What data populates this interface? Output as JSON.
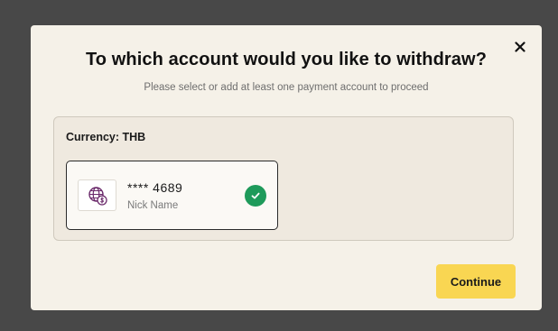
{
  "dialog": {
    "title": "To which account would you like to withdraw?",
    "subtitle": "Please select or add at least one payment account to proceed",
    "close_icon": "close-icon"
  },
  "currency": {
    "label": "Currency: THB"
  },
  "account": {
    "number": "**** 4689",
    "nick_name": "Nick Name",
    "icon": "globe-dollar-icon",
    "selected": true,
    "check_icon": "check-icon"
  },
  "actions": {
    "continue_label": "Continue"
  },
  "colors": {
    "overlay": "#484848",
    "modal_bg": "#f5f1e8",
    "panel_bg": "#efe9df",
    "accent_button": "#f9d652",
    "check_green": "#1e9a5a",
    "icon_purple": "#6b2a6b"
  }
}
